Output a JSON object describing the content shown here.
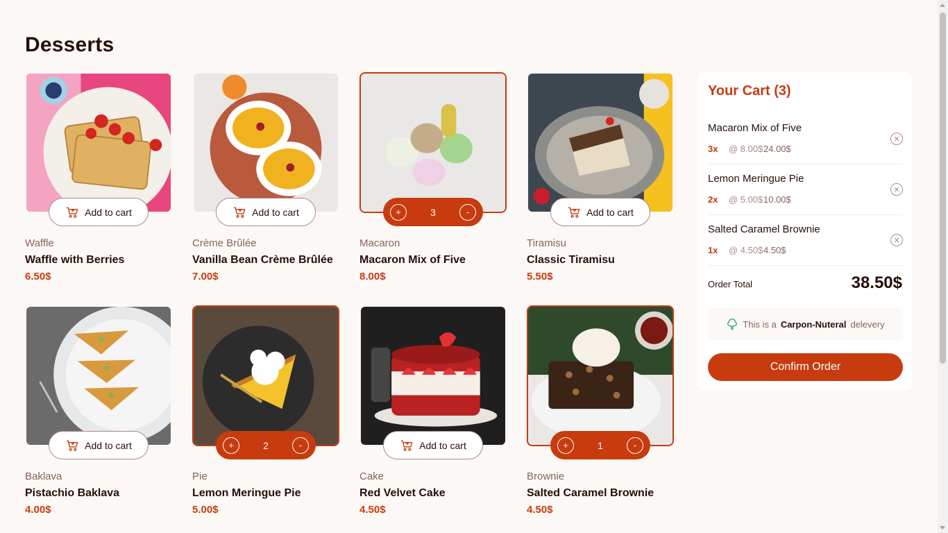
{
  "page": {
    "title": "Desserts"
  },
  "products": [
    {
      "category": "Waffle",
      "name": "Waffle with Berries",
      "price": "6.50$",
      "in_cart": false,
      "button_label": "Add to cart",
      "image": "waffle"
    },
    {
      "category": "Crème Brûlée",
      "name": "Vanilla Bean Crème Brûlée",
      "price": "7.00$",
      "in_cart": false,
      "button_label": "Add to cart",
      "image": "creme-brulee"
    },
    {
      "category": "Macaron",
      "name": "Macaron Mix of Five",
      "price": "8.00$",
      "in_cart": true,
      "quantity": "3",
      "image": "macaron"
    },
    {
      "category": "Tiramisu",
      "name": "Classic Tiramisu",
      "price": "5.50$",
      "in_cart": false,
      "button_label": "Add to cart",
      "image": "tiramisu"
    },
    {
      "category": "Baklava",
      "name": "Pistachio Baklava",
      "price": "4.00$",
      "in_cart": false,
      "button_label": "Add to cart",
      "image": "baklava"
    },
    {
      "category": "Pie",
      "name": "Lemon Meringue Pie",
      "price": "5.00$",
      "in_cart": true,
      "quantity": "2",
      "image": "pie"
    },
    {
      "category": "Cake",
      "name": "Red Velvet Cake",
      "price": "4.50$",
      "in_cart": false,
      "button_label": "Add to cart",
      "image": "cake"
    },
    {
      "category": "Brownie",
      "name": "Salted Caramel Brownie",
      "price": "4.50$",
      "in_cart": true,
      "quantity": "1",
      "image": "brownie"
    }
  ],
  "controls": {
    "increment": "+",
    "decrement": "-"
  },
  "cart": {
    "title": "Your Cart (3)",
    "items": [
      {
        "name": "Macaron Mix of Five",
        "qty": "3x",
        "unit": "@ 8.00$",
        "total": "24.00$"
      },
      {
        "name": "Lemon Meringue Pie",
        "qty": "2x",
        "unit": "@ 5.00$",
        "total": "10.00$"
      },
      {
        "name": "Salted Caramel Brownie",
        "qty": "1x",
        "unit": "@ 4.50$",
        "total": "4.50$"
      }
    ],
    "order_total_label": "Order Total",
    "order_total_value": "38.50$",
    "carbon_prefix": "This is a",
    "carbon_bold": "Carpon-Nuteral",
    "carbon_suffix": "delevery",
    "confirm_label": "Confirm Order"
  },
  "colors": {
    "accent": "#c73b0f",
    "background": "#fcf8f6",
    "text": "#260f08",
    "muted": "#87635a"
  }
}
